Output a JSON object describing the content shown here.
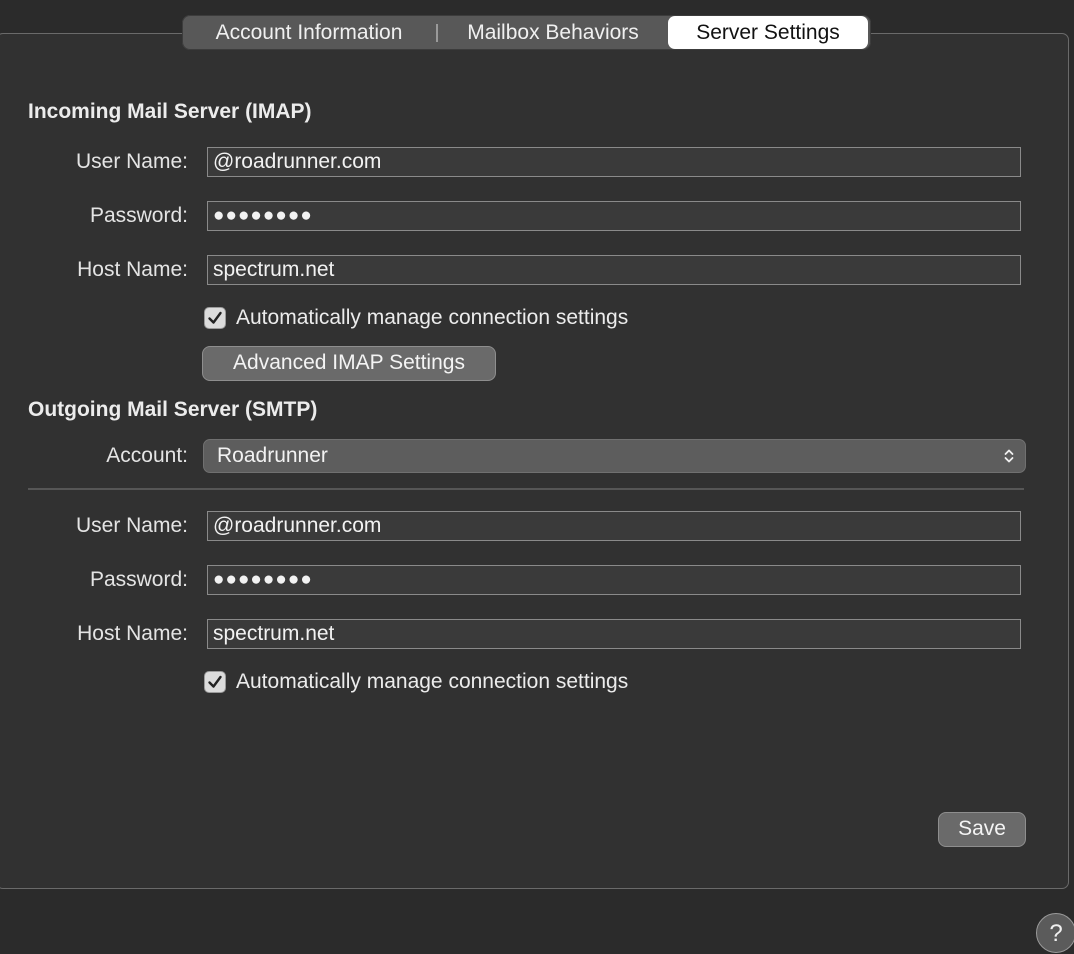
{
  "tabs": [
    {
      "label": "Account Information",
      "selected": false
    },
    {
      "label": "Mailbox Behaviors",
      "selected": false
    },
    {
      "label": "Server Settings",
      "selected": true
    }
  ],
  "incoming": {
    "title": "Incoming Mail Server (IMAP)",
    "user_name_label": "User Name:",
    "user_name_value": "@roadrunner.com",
    "password_label": "Password:",
    "password_value": "●●●●●●●●",
    "host_name_label": "Host Name:",
    "host_name_value": "spectrum.net",
    "auto_manage_label": "Automatically manage connection settings",
    "auto_manage_checked": true,
    "advanced_button_label": "Advanced IMAP Settings"
  },
  "outgoing": {
    "title": "Outgoing Mail Server (SMTP)",
    "account_label": "Account:",
    "account_value": "Roadrunner",
    "user_name_label": "User Name:",
    "user_name_value": "@roadrunner.com",
    "password_label": "Password:",
    "password_value": "●●●●●●●●",
    "host_name_label": "Host Name:",
    "host_name_value": "spectrum.net",
    "auto_manage_label": "Automatically manage connection settings",
    "auto_manage_checked": true
  },
  "footer": {
    "save_label": "Save",
    "help_label": "?"
  },
  "colors": {
    "background": "#2b2b2b",
    "panel": "#313131",
    "selected_tab": "#ffffff",
    "button": "#6a6a6a"
  },
  "icons": {
    "checkbox": "checkmark-icon",
    "select": "up-down-chevron-icon",
    "help": "question-mark-icon"
  }
}
